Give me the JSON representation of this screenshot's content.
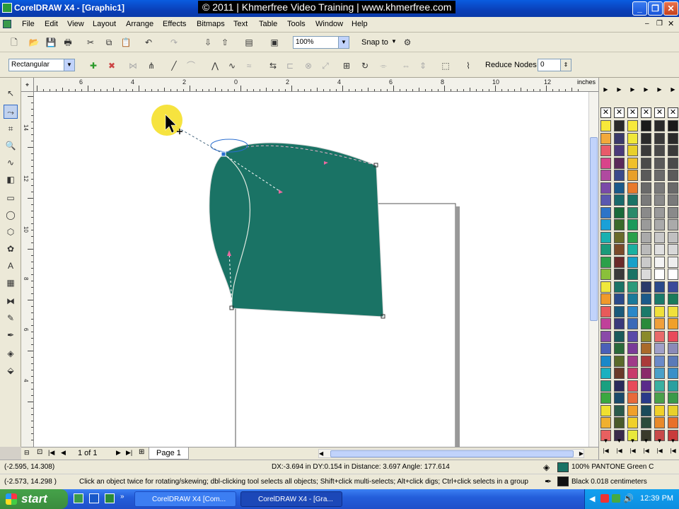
{
  "window": {
    "title": "CorelDRAW X4 - [Graphic1]",
    "watermark": "© 2011 | Khmerfree Video Training | www.khmerfree.com"
  },
  "menu": [
    "File",
    "Edit",
    "View",
    "Layout",
    "Arrange",
    "Effects",
    "Bitmaps",
    "Text",
    "Table",
    "Tools",
    "Window",
    "Help"
  ],
  "toolbar": {
    "zoom_value": "100%",
    "snap_label": "Snap to"
  },
  "property_bar": {
    "shape_mode": "Rectangular",
    "reduce_nodes_label": "Reduce Nodes",
    "reduce_nodes_value": "0"
  },
  "ruler": {
    "unit": "inches",
    "top_labels": [
      "6",
      "4",
      "2",
      "0",
      "2",
      "4",
      "6",
      "8",
      "10",
      "12"
    ],
    "left_labels": [
      "14",
      "12",
      "10",
      "8",
      "6",
      "4"
    ]
  },
  "page_nav": {
    "page_count": "1 of 1",
    "page_tab": "Page 1"
  },
  "status": {
    "cursor_pos": "(-2.595, 14.308)",
    "object_pos": "(-2.573, 14.298 )",
    "delta": "DX:-3.694 in DY:0.154 in Distance: 3.697 Angle: 177.614",
    "hint": "Click an object twice for rotating/skewing; dbl-clicking tool selects all objects; Shift+click multi-selects; Alt+click digs; Ctrl+click selects in a group",
    "fill": "100% PANTONE Green C",
    "outline": "Black  0.018 centimeters"
  },
  "colors": {
    "fill": "#1a7365",
    "fill_outline": "#d8d8d8"
  },
  "taskbar": {
    "start": "start",
    "tasks": [
      "CorelDRAW X4 [Com...",
      "CorelDRAW X4 - [Gra..."
    ],
    "clock": "12:39 PM"
  },
  "tools": [
    "pick-tool",
    "shape-tool",
    "crop-tool",
    "zoom-tool",
    "freehand-tool",
    "smart-fill-tool",
    "rectangle-tool",
    "ellipse-tool",
    "polygon-tool",
    "basic-shapes-tool",
    "text-tool",
    "table-tool",
    "eyedropper-tool",
    "outline-tool",
    "fill-tool",
    "interactive-fill-tool"
  ]
}
